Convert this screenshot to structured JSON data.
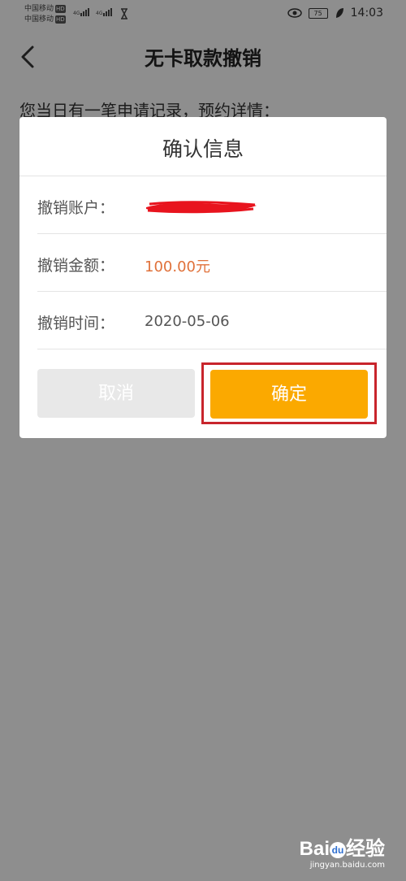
{
  "status_bar": {
    "carrier_1": "中国移动",
    "carrier_2": "中国移动",
    "hd_badge": "HD",
    "network": "4G",
    "battery": "75",
    "time": "14:03"
  },
  "nav": {
    "title": "无卡取款撤销",
    "back_icon": "chevron-left-icon"
  },
  "page": {
    "intro_text": "您当日有一笔申请记录，预约详情："
  },
  "dialog": {
    "title": "确认信息",
    "rows": [
      {
        "label": "撤销账户：",
        "value": ""
      },
      {
        "label": "撤销金额：",
        "value": "100.00元"
      },
      {
        "label": "撤销时间：",
        "value": "2020-05-06"
      }
    ],
    "cancel_label": "取消",
    "confirm_label": "确定"
  },
  "watermark": {
    "logo_text_1": "Bai",
    "logo_paw": "du",
    "logo_text_2": "经验",
    "url": "jingyan.baidu.com"
  },
  "colors": {
    "confirm_button": "#fba900",
    "amount_text": "#e0713a",
    "highlight_frame": "#c8252c",
    "redaction": "#e8141e"
  }
}
